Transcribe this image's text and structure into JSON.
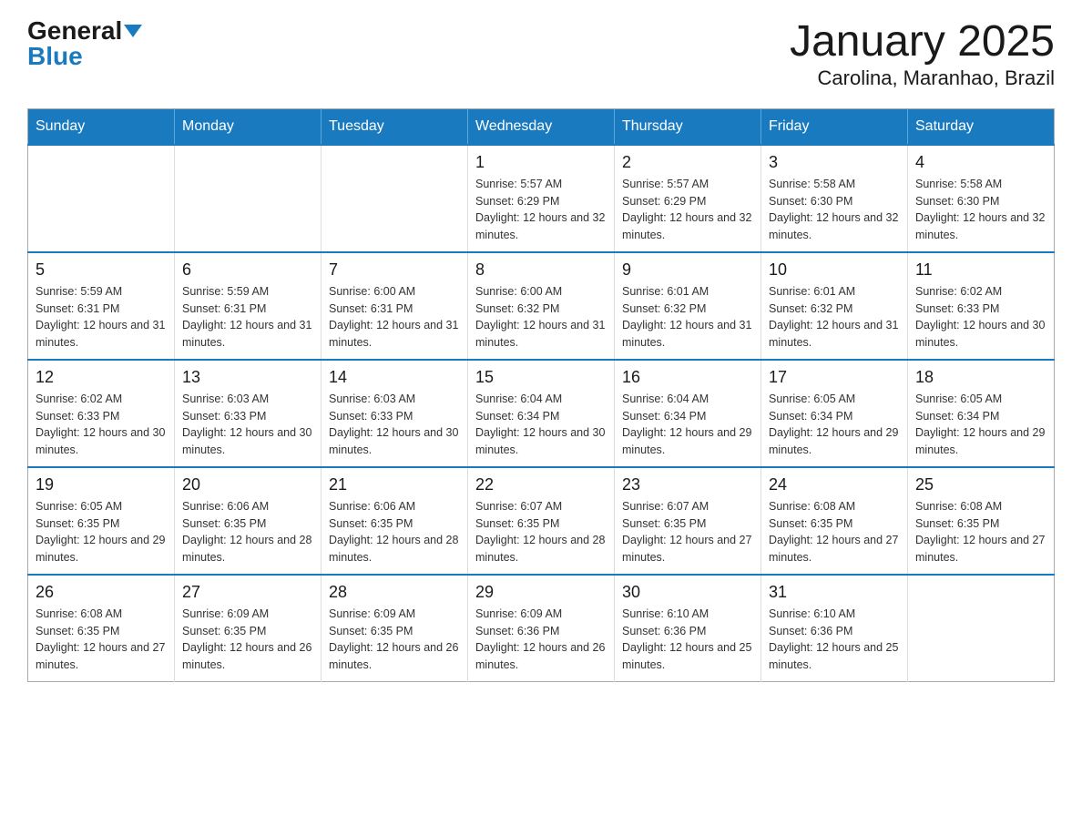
{
  "logo": {
    "general": "General",
    "blue": "Blue"
  },
  "title": "January 2025",
  "subtitle": "Carolina, Maranhao, Brazil",
  "days_of_week": [
    "Sunday",
    "Monday",
    "Tuesday",
    "Wednesday",
    "Thursday",
    "Friday",
    "Saturday"
  ],
  "weeks": [
    [
      {
        "day": "",
        "info": ""
      },
      {
        "day": "",
        "info": ""
      },
      {
        "day": "",
        "info": ""
      },
      {
        "day": "1",
        "info": "Sunrise: 5:57 AM\nSunset: 6:29 PM\nDaylight: 12 hours and 32 minutes."
      },
      {
        "day": "2",
        "info": "Sunrise: 5:57 AM\nSunset: 6:29 PM\nDaylight: 12 hours and 32 minutes."
      },
      {
        "day": "3",
        "info": "Sunrise: 5:58 AM\nSunset: 6:30 PM\nDaylight: 12 hours and 32 minutes."
      },
      {
        "day": "4",
        "info": "Sunrise: 5:58 AM\nSunset: 6:30 PM\nDaylight: 12 hours and 32 minutes."
      }
    ],
    [
      {
        "day": "5",
        "info": "Sunrise: 5:59 AM\nSunset: 6:31 PM\nDaylight: 12 hours and 31 minutes."
      },
      {
        "day": "6",
        "info": "Sunrise: 5:59 AM\nSunset: 6:31 PM\nDaylight: 12 hours and 31 minutes."
      },
      {
        "day": "7",
        "info": "Sunrise: 6:00 AM\nSunset: 6:31 PM\nDaylight: 12 hours and 31 minutes."
      },
      {
        "day": "8",
        "info": "Sunrise: 6:00 AM\nSunset: 6:32 PM\nDaylight: 12 hours and 31 minutes."
      },
      {
        "day": "9",
        "info": "Sunrise: 6:01 AM\nSunset: 6:32 PM\nDaylight: 12 hours and 31 minutes."
      },
      {
        "day": "10",
        "info": "Sunrise: 6:01 AM\nSunset: 6:32 PM\nDaylight: 12 hours and 31 minutes."
      },
      {
        "day": "11",
        "info": "Sunrise: 6:02 AM\nSunset: 6:33 PM\nDaylight: 12 hours and 30 minutes."
      }
    ],
    [
      {
        "day": "12",
        "info": "Sunrise: 6:02 AM\nSunset: 6:33 PM\nDaylight: 12 hours and 30 minutes."
      },
      {
        "day": "13",
        "info": "Sunrise: 6:03 AM\nSunset: 6:33 PM\nDaylight: 12 hours and 30 minutes."
      },
      {
        "day": "14",
        "info": "Sunrise: 6:03 AM\nSunset: 6:33 PM\nDaylight: 12 hours and 30 minutes."
      },
      {
        "day": "15",
        "info": "Sunrise: 6:04 AM\nSunset: 6:34 PM\nDaylight: 12 hours and 30 minutes."
      },
      {
        "day": "16",
        "info": "Sunrise: 6:04 AM\nSunset: 6:34 PM\nDaylight: 12 hours and 29 minutes."
      },
      {
        "day": "17",
        "info": "Sunrise: 6:05 AM\nSunset: 6:34 PM\nDaylight: 12 hours and 29 minutes."
      },
      {
        "day": "18",
        "info": "Sunrise: 6:05 AM\nSunset: 6:34 PM\nDaylight: 12 hours and 29 minutes."
      }
    ],
    [
      {
        "day": "19",
        "info": "Sunrise: 6:05 AM\nSunset: 6:35 PM\nDaylight: 12 hours and 29 minutes."
      },
      {
        "day": "20",
        "info": "Sunrise: 6:06 AM\nSunset: 6:35 PM\nDaylight: 12 hours and 28 minutes."
      },
      {
        "day": "21",
        "info": "Sunrise: 6:06 AM\nSunset: 6:35 PM\nDaylight: 12 hours and 28 minutes."
      },
      {
        "day": "22",
        "info": "Sunrise: 6:07 AM\nSunset: 6:35 PM\nDaylight: 12 hours and 28 minutes."
      },
      {
        "day": "23",
        "info": "Sunrise: 6:07 AM\nSunset: 6:35 PM\nDaylight: 12 hours and 27 minutes."
      },
      {
        "day": "24",
        "info": "Sunrise: 6:08 AM\nSunset: 6:35 PM\nDaylight: 12 hours and 27 minutes."
      },
      {
        "day": "25",
        "info": "Sunrise: 6:08 AM\nSunset: 6:35 PM\nDaylight: 12 hours and 27 minutes."
      }
    ],
    [
      {
        "day": "26",
        "info": "Sunrise: 6:08 AM\nSunset: 6:35 PM\nDaylight: 12 hours and 27 minutes."
      },
      {
        "day": "27",
        "info": "Sunrise: 6:09 AM\nSunset: 6:35 PM\nDaylight: 12 hours and 26 minutes."
      },
      {
        "day": "28",
        "info": "Sunrise: 6:09 AM\nSunset: 6:35 PM\nDaylight: 12 hours and 26 minutes."
      },
      {
        "day": "29",
        "info": "Sunrise: 6:09 AM\nSunset: 6:36 PM\nDaylight: 12 hours and 26 minutes."
      },
      {
        "day": "30",
        "info": "Sunrise: 6:10 AM\nSunset: 6:36 PM\nDaylight: 12 hours and 25 minutes."
      },
      {
        "day": "31",
        "info": "Sunrise: 6:10 AM\nSunset: 6:36 PM\nDaylight: 12 hours and 25 minutes."
      },
      {
        "day": "",
        "info": ""
      }
    ]
  ]
}
